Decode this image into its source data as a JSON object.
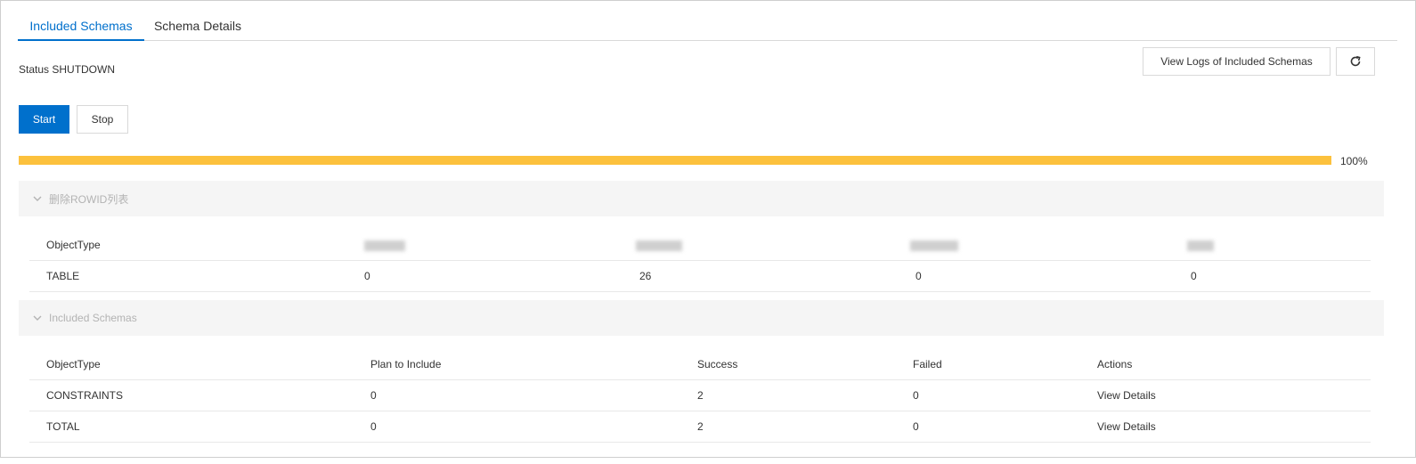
{
  "tabs": [
    {
      "label": "Included Schemas",
      "active": true
    },
    {
      "label": "Schema Details",
      "active": false
    }
  ],
  "status": {
    "text": "Status SHUTDOWN"
  },
  "toolbar": {
    "view_logs_label": "View Logs of Included Schemas",
    "refresh_icon": "refresh-icon"
  },
  "actions": {
    "start_label": "Start",
    "stop_label": "Stop"
  },
  "progress": {
    "value": 100,
    "label": "100%",
    "color": "#fcc13d"
  },
  "rowid_section": {
    "title": "删除ROWID列表",
    "header": {
      "col1": "ObjectType"
    },
    "rows": [
      {
        "object_type": "TABLE",
        "c2": "0",
        "c3": "26",
        "c4": "0",
        "c5": "0"
      }
    ]
  },
  "schemas_section": {
    "title": "Included Schemas",
    "header": {
      "col1": "ObjectType",
      "col2": "Plan to Include",
      "col3": "Success",
      "col4": "Failed",
      "col5": "Actions"
    },
    "rows": [
      {
        "object_type": "CONSTRAINTS",
        "plan": "0",
        "success": "2",
        "failed": "0",
        "action": "View Details"
      },
      {
        "object_type": "TOTAL",
        "plan": "0",
        "success": "2",
        "failed": "0",
        "action": "View Details"
      }
    ]
  },
  "colors": {
    "accent": "#0070cc",
    "progress": "#fcc13d"
  }
}
